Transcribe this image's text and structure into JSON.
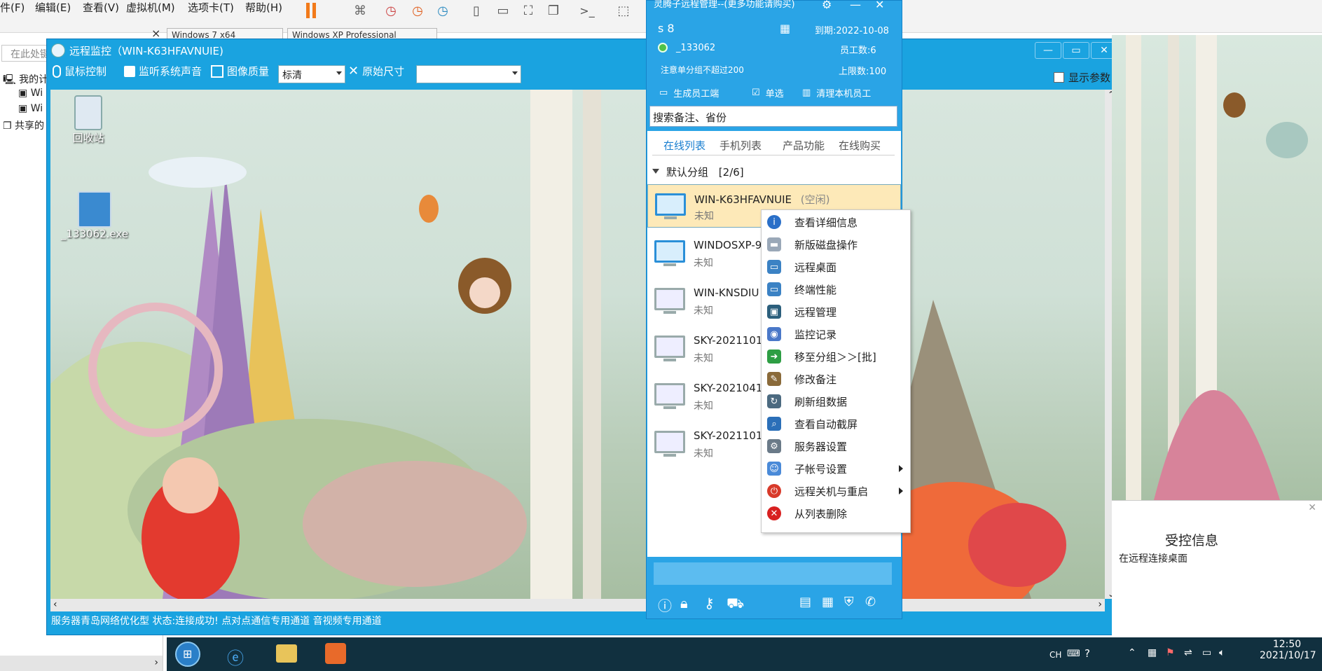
{
  "vm_menu": {
    "items": [
      "件(F)",
      "编辑(E)",
      "查看(V)",
      "虚拟机(M)",
      "选项卡(T)",
      "帮助(H)"
    ],
    "search_placeholder": "在此处键",
    "vm_tabs": [
      "Windows 7 x64",
      "Windows XP Professional"
    ]
  },
  "tree": {
    "items": [
      "我的计",
      "Wi",
      "Wi",
      "共享的"
    ]
  },
  "remote": {
    "title": "远程监控（WIN-K63HFAVNUIE)",
    "tools": [
      "鼠标控制",
      "监听系统声音",
      "图像质量",
      "原始尺寸"
    ],
    "quality_value": "标清",
    "size_value": "",
    "show_params": "显示参数",
    "desktop_icons": [
      "回收站",
      "_133062.exe"
    ],
    "status": "服务器青岛网络优化型 状态:连接成功!  点对点通信专用通道  音视频专用通道"
  },
  "panel": {
    "title": "灵腾子远程管理--(更多功能请购买)",
    "username": "s        8",
    "user_id": "_133062",
    "expiry": "到期:2022-10-08",
    "employees": "员工数:6",
    "note": "注意单分组不超过200",
    "limit": "上限数:100",
    "actions": [
      "生成员工端",
      "单选",
      "清理本机员工"
    ],
    "search_placeholder": "搜索备注、省份",
    "tabs": [
      "在线列表",
      "手机列表",
      "产品功能",
      "在线购买"
    ],
    "group_label": "默认分组",
    "group_count": "[2/6]",
    "clients": [
      {
        "name": "WIN-K63HFAVNUIE",
        "state": "(空闲)",
        "sub": "未知"
      },
      {
        "name": "WINDOSXP-9",
        "state": "",
        "sub": "未知"
      },
      {
        "name": "WIN-KNSDIU",
        "state": "",
        "sub": "未知"
      },
      {
        "name": "SKY-2021101",
        "state": "",
        "sub": "未知"
      },
      {
        "name": "SKY-2021041",
        "state": "",
        "sub": "未知"
      },
      {
        "name": "SKY-2021101",
        "state": "",
        "sub": "未知"
      }
    ]
  },
  "context_menu": [
    {
      "label": "查看详细信息",
      "icon": "info-icon",
      "color": "#2a6fc8"
    },
    {
      "label": "新版磁盘操作",
      "icon": "disk-icon",
      "color": "#9aa8b8"
    },
    {
      "label": "远程桌面",
      "icon": "remote-desktop-icon",
      "color": "#3b82c4"
    },
    {
      "label": "终端性能",
      "icon": "terminal-icon",
      "color": "#3b82c4"
    },
    {
      "label": "远程管理",
      "icon": "manage-icon",
      "color": "#2c5f7c"
    },
    {
      "label": "监控记录",
      "icon": "record-icon",
      "color": "#4a78c8"
    },
    {
      "label": "移至分组＞＞[批]",
      "icon": "move-icon",
      "color": "#2e9e44"
    },
    {
      "label": "修改备注",
      "icon": "edit-icon",
      "color": "#8a6a3a"
    },
    {
      "label": "刷新组数据",
      "icon": "refresh-icon",
      "color": "#4c6a80"
    },
    {
      "label": "查看自动截屏",
      "icon": "magnifier-icon",
      "color": "#2b6fb8"
    },
    {
      "label": "服务器设置",
      "icon": "gear-icon",
      "color": "#6a7a88"
    },
    {
      "label": "子帐号设置",
      "icon": "users-icon",
      "color": "#4a8ad8"
    },
    {
      "label": "远程关机与重启",
      "icon": "power-icon",
      "color": "#d83a2a"
    },
    {
      "label": "从列表删除",
      "icon": "delete-icon",
      "color": "#d82020"
    }
  ],
  "notice": {
    "title": "受控信息",
    "text": "在远程连接桌面"
  },
  "taskbar": {
    "lang": "CH",
    "time": "12:50",
    "date": "2021/10/17"
  }
}
